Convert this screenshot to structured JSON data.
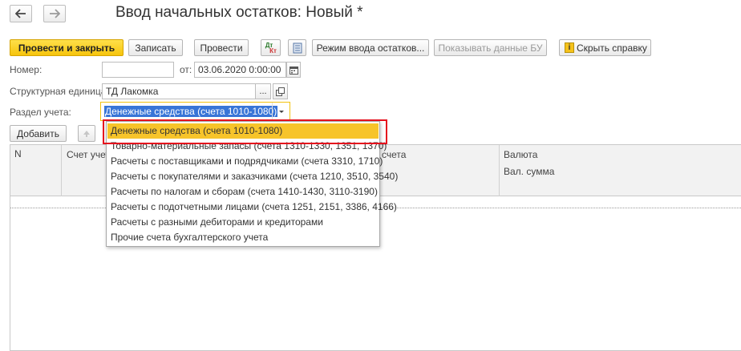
{
  "window": {
    "title": "Ввод начальных остатков: Новый *"
  },
  "toolbar": {
    "post_close": "Провести и закрыть",
    "save": "Записать",
    "post": "Провести",
    "dt_kt_line1": "Дт",
    "dt_kt_line2": "Кт",
    "mode": "Режим ввода остатков...",
    "show_bu": "Показывать данные БУ",
    "hide_help": "Скрыть справку"
  },
  "form": {
    "number_label": "Номер:",
    "number_value": "",
    "date_label": "от:",
    "date_value": "03.06.2020  0:00:00",
    "unit_label": "Структурная единица:",
    "unit_value": "ТД Лакомка",
    "unit_dots": "...",
    "section_label": "Раздел учета:",
    "section_value": "Денежные средства (счета 1010-1080)"
  },
  "table_toolbar": {
    "add": "Добавить"
  },
  "table": {
    "columns": {
      "n": "N",
      "account": "Счет учета",
      "account2": "счета",
      "currency": "Валюта",
      "cur_sum": "Вал. сумма"
    }
  },
  "dropdown": {
    "options": [
      "Денежные средства (счета 1010-1080)",
      "Товарно-материальные запасы (счета 1310-1330, 1351, 1370)",
      "Расчеты с поставщиками и подрядчиками (счета 3310, 1710)",
      "Расчеты с покупателями и заказчиками (счета 1210, 3510, 3540)",
      "Расчеты по налогам и сборам (счета 1410-1430, 3110-3190)",
      "Расчеты с подотчетными лицами (счета 1251, 2151, 3386, 4166)",
      "Расчеты с разными дебиторами и кредиторами",
      "Прочие счета бухгалтерского учета"
    ],
    "selected_index": 0
  },
  "colors": {
    "accent_yellow": "#f6c40c",
    "highlight_red": "#e5101d",
    "selection_blue": "#3875d7"
  }
}
